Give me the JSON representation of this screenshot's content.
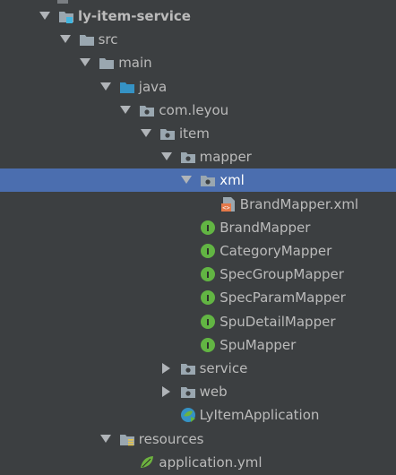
{
  "tree": {
    "nodes": [
      {
        "label": "ly-item-service",
        "bold": true,
        "icon": "module-folder-icon",
        "arrow": "expanded",
        "depth": 0,
        "selected": false,
        "name": "module-ly-item-service"
      },
      {
        "label": "src",
        "icon": "folder-icon",
        "arrow": "expanded",
        "depth": 1,
        "selected": false,
        "name": "folder-src"
      },
      {
        "label": "main",
        "icon": "folder-icon",
        "arrow": "expanded",
        "depth": 2,
        "selected": false,
        "name": "folder-main"
      },
      {
        "label": "java",
        "icon": "source-folder-icon",
        "arrow": "expanded",
        "depth": 3,
        "selected": false,
        "name": "folder-java"
      },
      {
        "label": "com.leyou",
        "icon": "package-icon",
        "arrow": "expanded",
        "depth": 4,
        "selected": false,
        "name": "package-com-leyou"
      },
      {
        "label": "item",
        "icon": "package-icon",
        "arrow": "expanded",
        "depth": 5,
        "selected": false,
        "name": "package-item"
      },
      {
        "label": "mapper",
        "icon": "package-icon",
        "arrow": "expanded",
        "depth": 6,
        "selected": false,
        "name": "package-mapper"
      },
      {
        "label": "xml",
        "icon": "package-icon",
        "arrow": "expanded",
        "depth": 7,
        "selected": true,
        "name": "package-xml"
      },
      {
        "label": "BrandMapper.xml",
        "icon": "xml-file-icon",
        "arrow": "none",
        "depth": 8,
        "selected": false,
        "name": "file-brandmapper-xml"
      },
      {
        "label": "BrandMapper",
        "icon": "interface-icon",
        "arrow": "none",
        "depth": 7,
        "selected": false,
        "name": "interface-brandmapper"
      },
      {
        "label": "CategoryMapper",
        "icon": "interface-icon",
        "arrow": "none",
        "depth": 7,
        "selected": false,
        "name": "interface-categorymapper"
      },
      {
        "label": "SpecGroupMapper",
        "icon": "interface-icon",
        "arrow": "none",
        "depth": 7,
        "selected": false,
        "name": "interface-specgroupmapper"
      },
      {
        "label": "SpecParamMapper",
        "icon": "interface-icon",
        "arrow": "none",
        "depth": 7,
        "selected": false,
        "name": "interface-specparammapper"
      },
      {
        "label": "SpuDetailMapper",
        "icon": "interface-icon",
        "arrow": "none",
        "depth": 7,
        "selected": false,
        "name": "interface-spudetailmapper"
      },
      {
        "label": "SpuMapper",
        "icon": "interface-icon",
        "arrow": "none",
        "depth": 7,
        "selected": false,
        "name": "interface-spumapper"
      },
      {
        "label": "service",
        "icon": "package-icon",
        "arrow": "collapsed",
        "depth": 6,
        "selected": false,
        "name": "package-service"
      },
      {
        "label": "web",
        "icon": "package-icon",
        "arrow": "collapsed",
        "depth": 6,
        "selected": false,
        "name": "package-web"
      },
      {
        "label": "LyItemApplication",
        "icon": "spring-boot-app-icon",
        "arrow": "none",
        "depth": 6,
        "selected": false,
        "name": "class-lyitemapplication"
      },
      {
        "label": "resources",
        "icon": "resources-folder-icon",
        "arrow": "expanded",
        "depth": 3,
        "selected": false,
        "name": "folder-resources"
      },
      {
        "label": "application.yml",
        "icon": "spring-yml-icon",
        "arrow": "none",
        "depth": 4,
        "selected": false,
        "name": "file-application-yml"
      }
    ]
  },
  "colors": {
    "background": "#3c3f41",
    "selection": "#4b6eaf",
    "text": "#bbbbbb",
    "selected_text": "#ffffff",
    "folder": "#9aa7b0",
    "source_folder": "#3592c4",
    "interface_badge": "#62b543",
    "xml_badge": "#e57949",
    "spring": "#6db33f"
  }
}
